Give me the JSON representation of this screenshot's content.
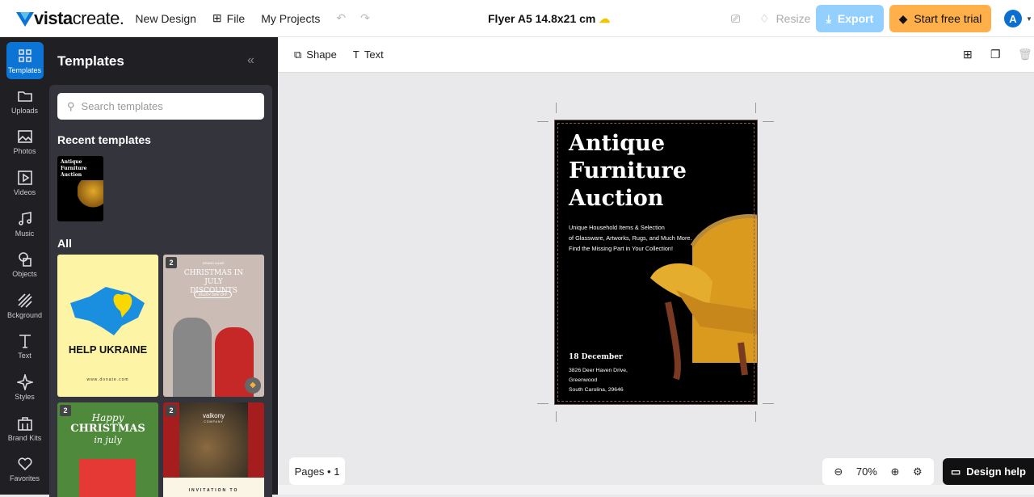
{
  "header": {
    "logo_bold": "vista",
    "logo_light": "create.",
    "new_design": "New Design",
    "file": "File",
    "my_projects": "My Projects",
    "doc_title": "Flyer A5 14.8x21 cm",
    "resize": "Resize",
    "export": "Export",
    "trial": "Start free trial",
    "avatar": "A"
  },
  "rail": [
    {
      "label": "Templates"
    },
    {
      "label": "Uploads"
    },
    {
      "label": "Photos"
    },
    {
      "label": "Videos"
    },
    {
      "label": "Music"
    },
    {
      "label": "Objects"
    },
    {
      "label": "Bckground"
    },
    {
      "label": "Text"
    },
    {
      "label": "Styles"
    },
    {
      "label": "Brand Kits"
    },
    {
      "label": "Favorites"
    }
  ],
  "panel": {
    "title": "Templates",
    "search_placeholder": "Search templates",
    "recent": "Recent templates",
    "all": "All",
    "templates": [
      {
        "text": "HELP UKRAINE",
        "sub": "www.donate.com"
      },
      {
        "badge": "2",
        "brand": "BRAND NAME",
        "text": "CHRISTMAS IN JULY DISCOUNTS",
        "sub": "ENJOY 30% OFF"
      },
      {
        "badge": "2",
        "text1": "Happy",
        "text2": "CHRISTMAS",
        "text3": "in july"
      },
      {
        "badge": "2",
        "brand": "valkony",
        "brand_sub": "COMPANY",
        "text": "INVITATION TO"
      }
    ],
    "recent_thumb": {
      "title": "Antique Furniture Auction"
    }
  },
  "toolbar": {
    "shape": "Shape",
    "text": "Text"
  },
  "flyer": {
    "title_lines": [
      "Antique",
      "Furniture",
      "Auction"
    ],
    "sub_lines": [
      "Unique Household Items & Selection",
      "of Glassware,  Artworks, Rugs, and Much More.",
      "Find the Missing Part  in Your Collection!"
    ],
    "date": "18 December",
    "address": [
      "3826 Deer Haven Drive,",
      "Greenwood",
      "South Carolina, 29646"
    ]
  },
  "footer": {
    "pages": "Pages • 1",
    "zoom": "70%",
    "design_help": "Design help"
  },
  "colors": {
    "accent": "#0b74d4",
    "trial": "#ffb04b",
    "export": "#94d0ff"
  }
}
